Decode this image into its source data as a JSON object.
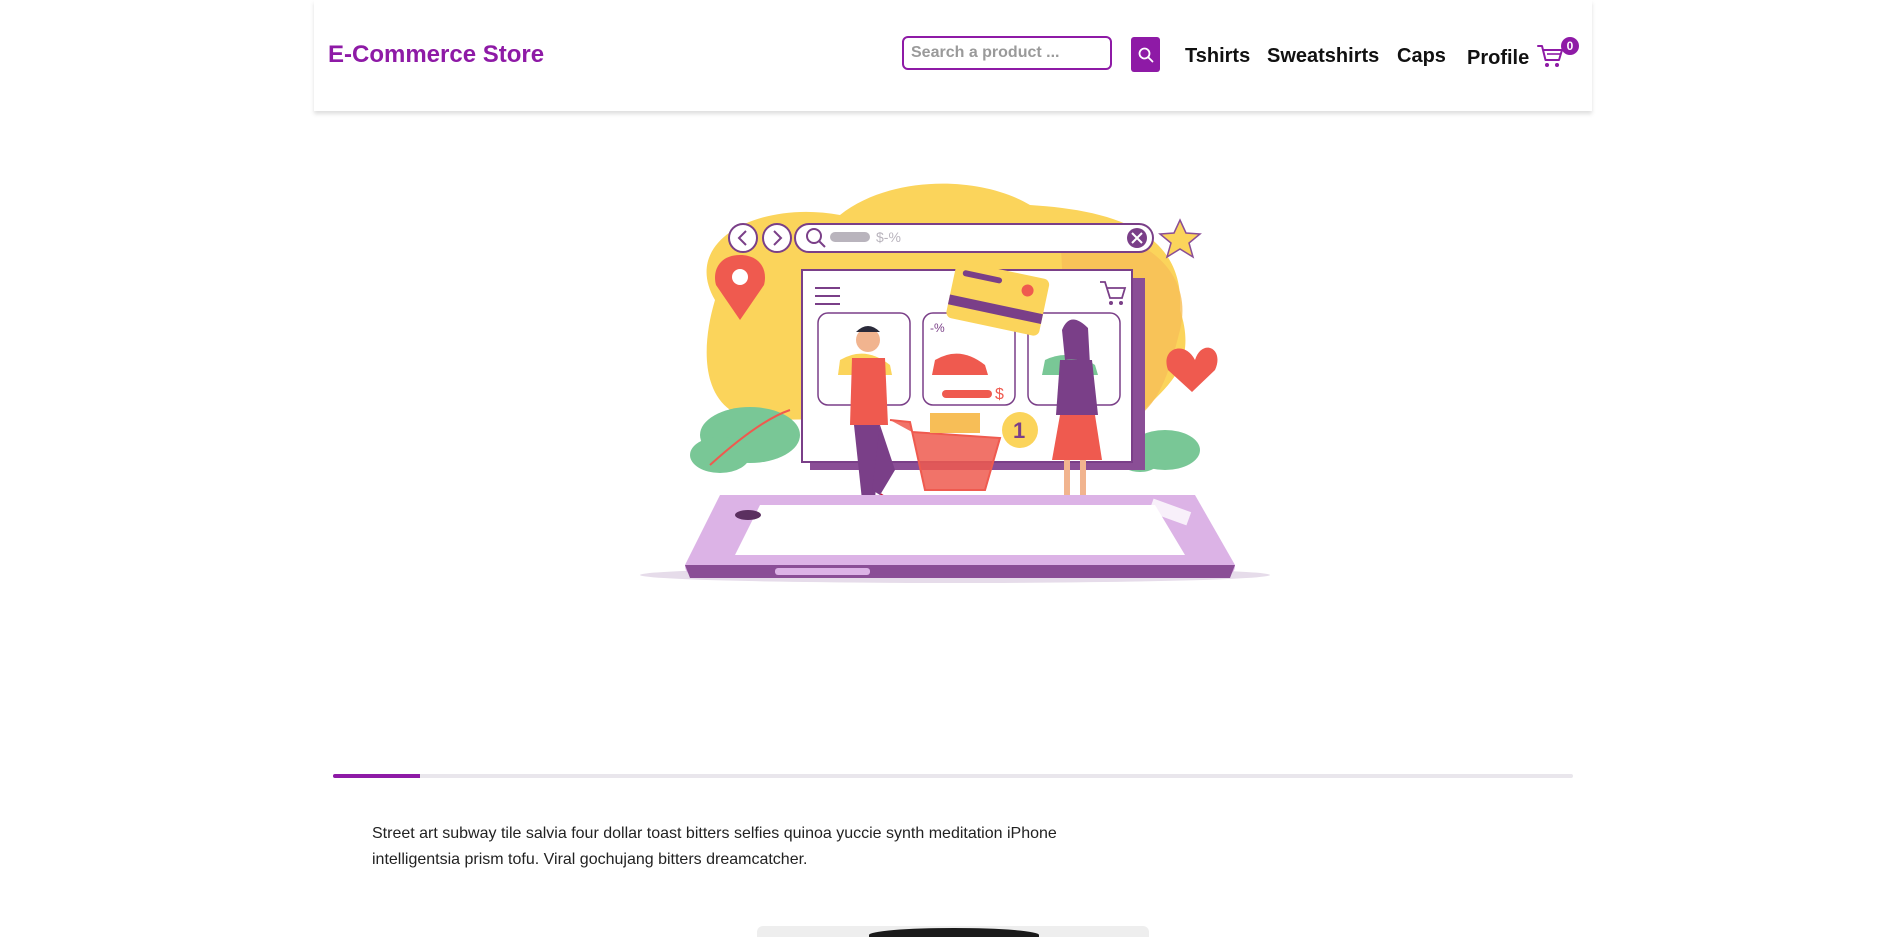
{
  "header": {
    "brand": "E-Commerce Store",
    "search": {
      "placeholder": "Search a product ...",
      "value": ""
    },
    "nav": [
      {
        "label": "Tshirts"
      },
      {
        "label": "Sweatshirts"
      },
      {
        "label": "Caps"
      },
      {
        "label": "Profile"
      }
    ],
    "cart_count": "0"
  },
  "hero": {
    "search_bar_text": "$-%",
    "discount_tag": "-%",
    "price_tag": "$",
    "cart_badge": "1"
  },
  "slider": {
    "progress_percent": 7
  },
  "description": "Street art subway tile salvia four dollar toast bitters selfies quinoa yuccie synth meditation iPhone intelligentsia prism tofu. Viral gochujang bitters dreamcatcher.",
  "colors": {
    "accent": "#8e1aa6",
    "purple_light": "#dcb3e6",
    "yellow": "#fbd45b",
    "red": "#ef5a4f",
    "green": "#79c796"
  }
}
